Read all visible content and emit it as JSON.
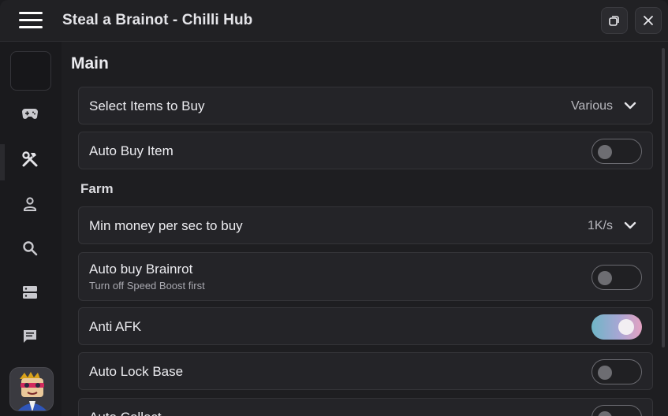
{
  "window": {
    "title": "Steal a Brainot - Chilli Hub"
  },
  "sidebar": {
    "items": [
      {
        "icon": "gamepad-icon"
      },
      {
        "icon": "tools-icon"
      },
      {
        "icon": "user-icon"
      },
      {
        "icon": "search-icon"
      },
      {
        "icon": "server-icon"
      },
      {
        "icon": "chat-icon"
      }
    ]
  },
  "main": {
    "section_title": "Main",
    "select_items": {
      "label": "Select Items to Buy",
      "value": "Various"
    },
    "auto_buy_item": {
      "label": "Auto Buy Item",
      "enabled": false
    },
    "farm_title": "Farm",
    "min_money": {
      "label": "Min money per sec to buy",
      "value": "1K/s"
    },
    "auto_buy_brainrot": {
      "label": "Auto buy Brainrot",
      "description": "Turn off Speed Boost first",
      "enabled": false
    },
    "anti_afk": {
      "label": "Anti AFK",
      "enabled": true
    },
    "auto_lock_base": {
      "label": "Auto Lock Base",
      "enabled": false
    },
    "auto_collect": {
      "label": "Auto Collect",
      "enabled": false
    }
  },
  "colors": {
    "accent_gradient_start": "#6fb6c6",
    "accent_gradient_end": "#e4a2c2",
    "panel": "#242428"
  }
}
